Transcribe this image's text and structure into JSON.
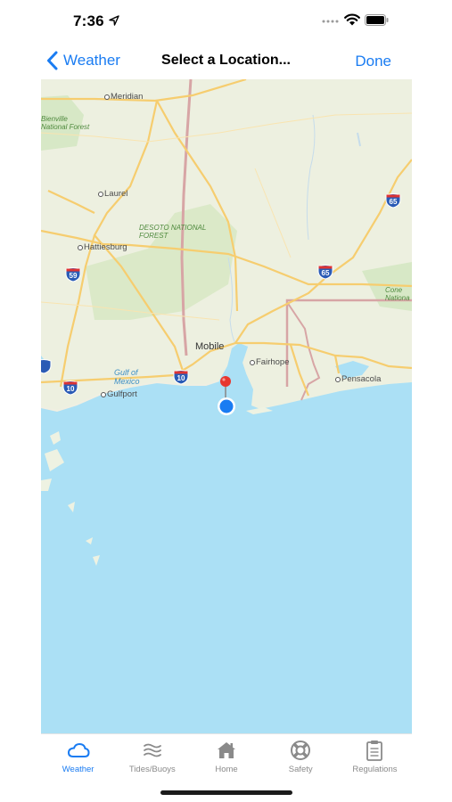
{
  "status_bar": {
    "time": "7:36",
    "icons": [
      "location-arrow-icon",
      "signal-dots-icon",
      "wifi-icon",
      "battery-icon"
    ]
  },
  "nav": {
    "back_label": "Weather",
    "title": "Select a Location...",
    "done_label": "Done"
  },
  "map": {
    "place_labels": {
      "meridian": "Meridian",
      "bienville": "Bienville\nNational Forest",
      "laurel": "Laurel",
      "desoto": "DESOTO NATIONAL\nFOREST",
      "hattiesburg": "Hattiesburg",
      "mobile": "Mobile",
      "fairhope": "Fairhope",
      "pensacola": "Pensacola",
      "gulf_of_mexico": "Gulf of\nMexico",
      "gulfport": "Gulfport",
      "conecuh": "Cone\nNationa"
    },
    "shields": {
      "i65_north": "65",
      "i65_south": "65",
      "i59": "59",
      "i10_west": "10",
      "i10_mobile": "10"
    },
    "colors": {
      "land": "#edf0e0",
      "water": "#abe0f5",
      "forest": "#d7e8c6",
      "highway": "#f6cd6f",
      "state_border": "#d7a5a5",
      "accent": "#1a7cf2",
      "pin": "#e8372f"
    },
    "markers": [
      "red-pin",
      "current-location-dot"
    ]
  },
  "tab_bar": {
    "tabs": [
      {
        "label": "Weather",
        "icon": "cloud-icon",
        "active": true
      },
      {
        "label": "Tides/Buoys",
        "icon": "waves-icon",
        "active": false
      },
      {
        "label": "Home",
        "icon": "house-icon",
        "active": false
      },
      {
        "label": "Safety",
        "icon": "life-ring-icon",
        "active": false
      },
      {
        "label": "Regulations",
        "icon": "clipboard-icon",
        "active": false
      }
    ]
  }
}
